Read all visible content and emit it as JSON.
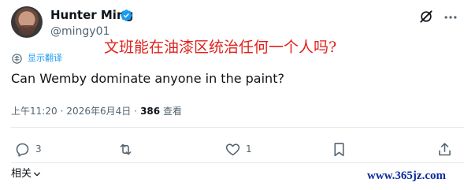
{
  "author": {
    "display_name": "Hunter Ming",
    "handle": "@mingy01"
  },
  "translate": {
    "label": "显示翻译"
  },
  "overlay_caption": "文班能在油漆区统治任何一个人吗?",
  "tweet": {
    "text": "Can Wemby dominate anyone in the paint?"
  },
  "meta": {
    "time": "上午11:20",
    "separator": "·",
    "date": "2026年6月4日",
    "views_count": "386",
    "views_label": "查看"
  },
  "actions": {
    "reply_count": "3",
    "retweet_count": "",
    "like_count": "1"
  },
  "related": {
    "label": "相关"
  },
  "watermark": "www.365jz.com",
  "colors": {
    "accent": "#1d9bf0",
    "muted_text": "#536471",
    "overlay_red": "#e0221b",
    "watermark_blue": "#0a2a9e"
  },
  "icons": {
    "verified": "verified-badge-icon",
    "grok": "grok-icon",
    "more": "more-icon",
    "translate": "translate-icon",
    "reply": "reply-icon",
    "retweet": "retweet-icon",
    "like": "heart-icon",
    "bookmark": "bookmark-icon",
    "share": "share-icon",
    "chevron": "chevron-down-icon"
  }
}
